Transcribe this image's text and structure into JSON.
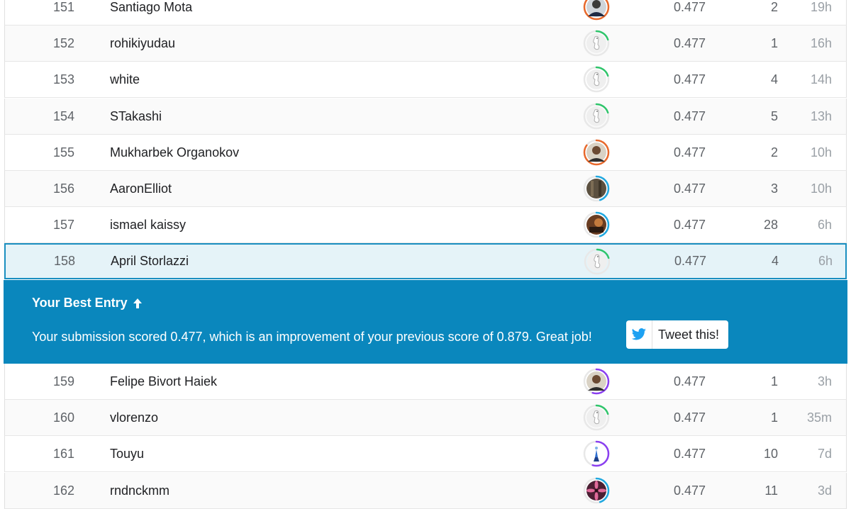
{
  "rows_top": [
    {
      "rank": "151",
      "name": "Santiago Mota",
      "score": "0.477",
      "entries": "2",
      "last": "19h",
      "avatar": "person-dark",
      "ring": "#e8692c",
      "ring_fraction": 0.85
    },
    {
      "rank": "152",
      "name": "rohikiyudau",
      "score": "0.477",
      "entries": "1",
      "last": "16h",
      "avatar": "default-goose",
      "ring": "#2fc56b",
      "ring_fraction": 0.2
    },
    {
      "rank": "153",
      "name": "white",
      "score": "0.477",
      "entries": "4",
      "last": "14h",
      "avatar": "default-goose",
      "ring": "#2fc56b",
      "ring_fraction": 0.2
    },
    {
      "rank": "154",
      "name": "STakashi",
      "score": "0.477",
      "entries": "5",
      "last": "13h",
      "avatar": "default-goose",
      "ring": "#2fc56b",
      "ring_fraction": 0.2
    },
    {
      "rank": "155",
      "name": "Mukharbek Organokov",
      "score": "0.477",
      "entries": "2",
      "last": "10h",
      "avatar": "person-light",
      "ring": "#e8692c",
      "ring_fraction": 0.85
    },
    {
      "rank": "156",
      "name": "AaronElliot",
      "score": "0.477",
      "entries": "3",
      "last": "10h",
      "avatar": "photo-dark",
      "ring": "#20a8e0",
      "ring_fraction": 0.45
    },
    {
      "rank": "157",
      "name": "ismael kaissy",
      "score": "0.477",
      "entries": "28",
      "last": "6h",
      "avatar": "photo-brown",
      "ring": "#20a8e0",
      "ring_fraction": 0.45
    },
    {
      "rank": "158",
      "name": "April Storlazzi",
      "score": "0.477",
      "entries": "4",
      "last": "6h",
      "avatar": "default-goose",
      "ring": "#2fc56b",
      "ring_fraction": 0.2
    }
  ],
  "banner": {
    "title": "Your Best Entry",
    "message": "Your submission scored 0.477, which is an improvement of your previous score of 0.879. Great job!",
    "tweet_label": "Tweet this!"
  },
  "rows_bottom": [
    {
      "rank": "159",
      "name": "Felipe Bivort Haiek",
      "score": "0.477",
      "entries": "1",
      "last": "3h",
      "avatar": "person-light",
      "ring": "#8a3ff0",
      "ring_fraction": 0.55
    },
    {
      "rank": "160",
      "name": "vlorenzo",
      "score": "0.477",
      "entries": "1",
      "last": "35m",
      "avatar": "default-goose",
      "ring": "#2fc56b",
      "ring_fraction": 0.2
    },
    {
      "rank": "161",
      "name": "Touyu",
      "score": "0.477",
      "entries": "10",
      "last": "7d",
      "avatar": "blue-figure",
      "ring": "#8a3ff0",
      "ring_fraction": 0.55
    },
    {
      "rank": "162",
      "name": "rndnckmm",
      "score": "0.477",
      "entries": "11",
      "last": "3d",
      "avatar": "pink-flower",
      "ring": "#20a8e0",
      "ring_fraction": 0.45
    }
  ],
  "colors": {
    "banner": "#0a87bd",
    "highlight_row": "#e5f3f8",
    "twitter": "#1da1f2"
  }
}
